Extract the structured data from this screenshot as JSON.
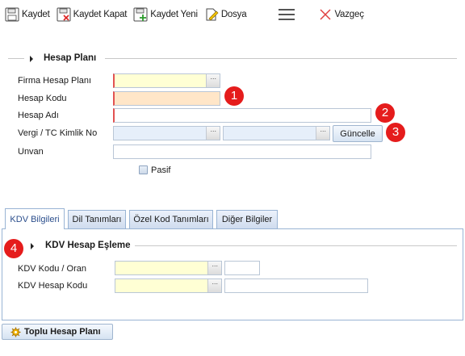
{
  "toolbar": {
    "save": "Kaydet",
    "save_close": "Kaydet Kapat",
    "save_new": "Kaydet Yeni",
    "file": "Dosya",
    "cancel": "Vazgeç"
  },
  "section_account": {
    "title": "Hesap Planı"
  },
  "form": {
    "firma_hesap_plani_label": "Firma Hesap Planı",
    "hesap_kodu_label": "Hesap Kodu",
    "hesap_adi_label": "Hesap Adı",
    "vergi_label": "Vergi / TC Kimlik No",
    "unvan_label": "Unvan",
    "pasif_label": "Pasif",
    "guncelle_label": "Güncelle",
    "lookup_dots": "···"
  },
  "badges": [
    "1",
    "2",
    "3",
    "4"
  ],
  "tabs": [
    {
      "label": "KDV Bilgileri",
      "active": true
    },
    {
      "label": "Dil Tanımları",
      "active": false
    },
    {
      "label": "Özel Kod Tanımları",
      "active": false
    },
    {
      "label": "Diğer Bilgiler",
      "active": false
    }
  ],
  "section_kdv": {
    "title": "KDV Hesap Eşleme"
  },
  "kdv": {
    "kdv_kodu_label": "KDV Kodu / Oran",
    "kdv_hesap_kodu_label": "KDV Hesap Kodu"
  },
  "bottom": {
    "toplu_label": "Toplu Hesap Planı"
  },
  "colors": {
    "required_border": "#e25252",
    "badge": "#e51c1c",
    "lookup_yellow": "#ffffd4",
    "required_peach": "#ffe6c8",
    "tab_border": "#99b4d4"
  }
}
